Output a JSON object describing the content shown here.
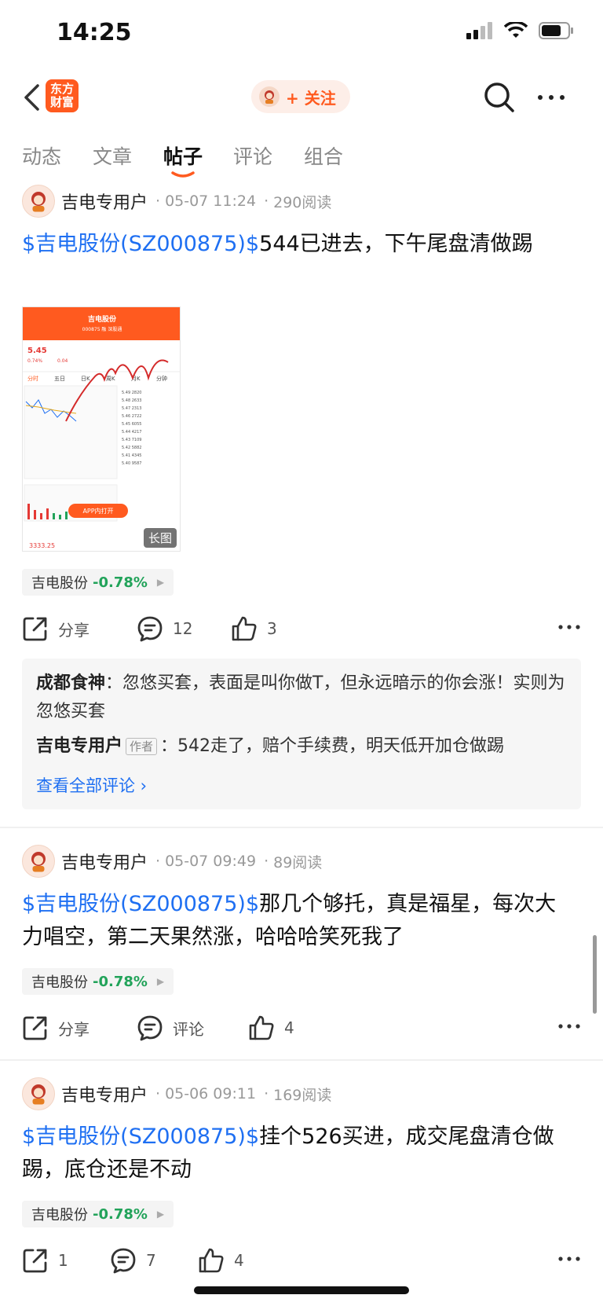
{
  "status": {
    "time": "14:25"
  },
  "nav": {
    "logo_text": "东方财富",
    "follow_label": "+ 关注"
  },
  "tabs": [
    "动态",
    "文章",
    "帖子",
    "评论",
    "组合"
  ],
  "posts": [
    {
      "author": "吉电专用户",
      "date": "05-07 11:24",
      "reads": "290阅读",
      "stock_link": "$吉电股份(SZ000875)$",
      "text": "544已进去，下午尾盘清做踢",
      "tag_name": "吉电股份",
      "tag_pct": "-0.78%",
      "share": "分享",
      "comment": "12",
      "like": "3",
      "image": {
        "title": "吉电股份",
        "subtitle": "000875 融 深股通",
        "price": "5.45",
        "pct": "0.74%",
        "chg": "0.04",
        "tabs": [
          "分时",
          "五日",
          "日K",
          "周K",
          "月K",
          "分钟"
        ],
        "app_btn": "APP内打开",
        "long_label": "长图",
        "index_value": "3333.25"
      }
    },
    {
      "author": "吉电专用户",
      "date": "05-07 09:49",
      "reads": "89阅读",
      "stock_link": "$吉电股份(SZ000875)$",
      "text": "那几个够托，真是福星，每次大力唱空，第二天果然涨，哈哈哈笑死我了",
      "tag_name": "吉电股份",
      "tag_pct": "-0.78%",
      "share": "分享",
      "comment": "评论",
      "like": "4"
    },
    {
      "author": "吉电专用户",
      "date": "05-06 09:11",
      "reads": "169阅读",
      "stock_link": "$吉电股份(SZ000875)$",
      "text": "挂个526买进，成交尾盘清仓做踢，底仓还是不动",
      "tag_name": "吉电股份",
      "tag_pct": "-0.78%",
      "share": "1",
      "comment": "7",
      "like": "4"
    }
  ],
  "comments": {
    "c1_name": "成都食神",
    "c1_text": "：忽悠买套，表面是叫你做T，但永远暗示的你会涨！实则为忽悠买套",
    "c2_name": "吉电专用户",
    "c2_tag": "作者",
    "c2_text": "：542走了，赔个手续费，明天低开加仓做踢",
    "view_all": "查看全部评论 ›"
  },
  "colors": {
    "accent": "#ff5a1f",
    "link": "#1e6ff2",
    "down": "#22a35a"
  }
}
